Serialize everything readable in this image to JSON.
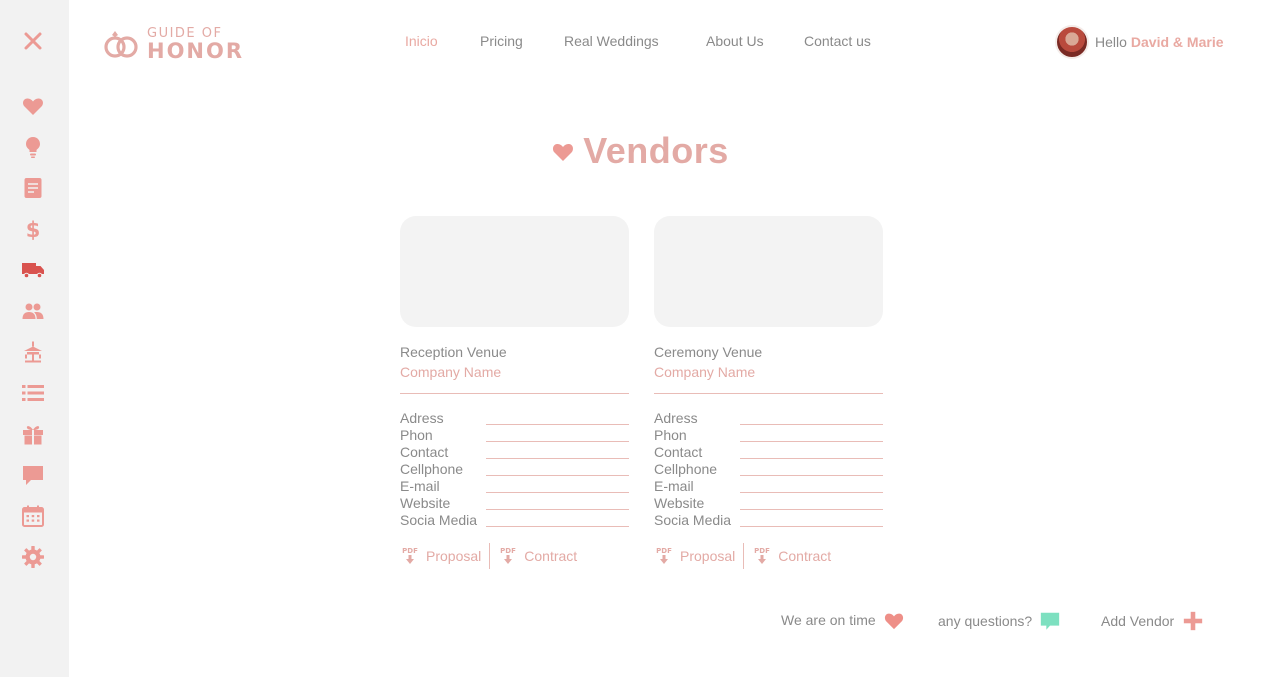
{
  "brand": {
    "line1": "GUIDE OF",
    "line2": "HONOR"
  },
  "nav": {
    "items": [
      {
        "label": "Inicio"
      },
      {
        "label": "Pricing"
      },
      {
        "label": "Real Weddings"
      },
      {
        "label": "About Us"
      },
      {
        "label": "Contact us"
      }
    ]
  },
  "user": {
    "greeting": "Hello",
    "name": "David & Marie"
  },
  "page": {
    "title": "Vendors"
  },
  "vendors": [
    {
      "type": "Reception Venue",
      "company": "Company Name",
      "fields": [
        "Adress",
        "Phon",
        "Contact",
        "Cellphone",
        "E-mail",
        "Website",
        "Socia Media"
      ],
      "proposal": "Proposal",
      "contract": "Contract"
    },
    {
      "type": "Ceremony Venue",
      "company": "Company Name",
      "fields": [
        "Adress",
        "Phon",
        "Contact",
        "Cellphone",
        "E-mail",
        "Website",
        "Socia Media"
      ],
      "proposal": "Proposal",
      "contract": "Contract"
    }
  ],
  "footer": {
    "on_time": "We are on time",
    "questions": "any questions?",
    "add_vendor": "Add Vendor"
  },
  "colors": {
    "accent": "#e3aaa5",
    "icon_pink": "#ec9a94",
    "chat_green": "#7de0c0",
    "sidebar_bg": "#f2f2f2"
  },
  "sidebar_icons": [
    "close-icon",
    "heart-icon",
    "lightbulb-icon",
    "notes-icon",
    "dollar-icon",
    "truck-icon",
    "users-icon",
    "cake-icon",
    "list-icon",
    "gift-icon",
    "chat-icon",
    "calendar-icon",
    "settings-icon"
  ]
}
